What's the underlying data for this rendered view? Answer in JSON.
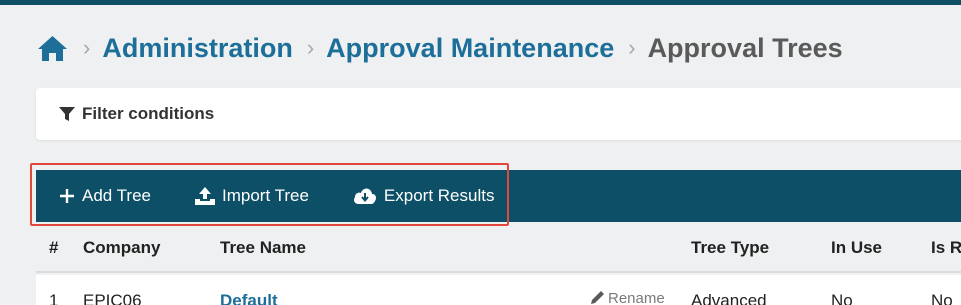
{
  "breadcrumb": {
    "items": [
      {
        "label": "Administration"
      },
      {
        "label": "Approval Maintenance"
      }
    ],
    "current": "Approval Trees"
  },
  "filter": {
    "label": "Filter conditions"
  },
  "toolbar": {
    "add_label": "Add Tree",
    "import_label": "Import Tree",
    "export_label": "Export Results"
  },
  "table": {
    "columns": [
      "#",
      "Company",
      "Tree Name",
      "Tree Type",
      "In Use",
      "Is R"
    ],
    "rows": [
      {
        "num": "1",
        "company": "EPIC06",
        "tree_name": "Default",
        "action": "Rename",
        "tree_type": "Advanced",
        "in_use": "No",
        "is_r": "No"
      }
    ]
  },
  "colors": {
    "accent": "#1d6f9a",
    "toolbar": "#0c4f66",
    "highlight": "#e2473c"
  }
}
